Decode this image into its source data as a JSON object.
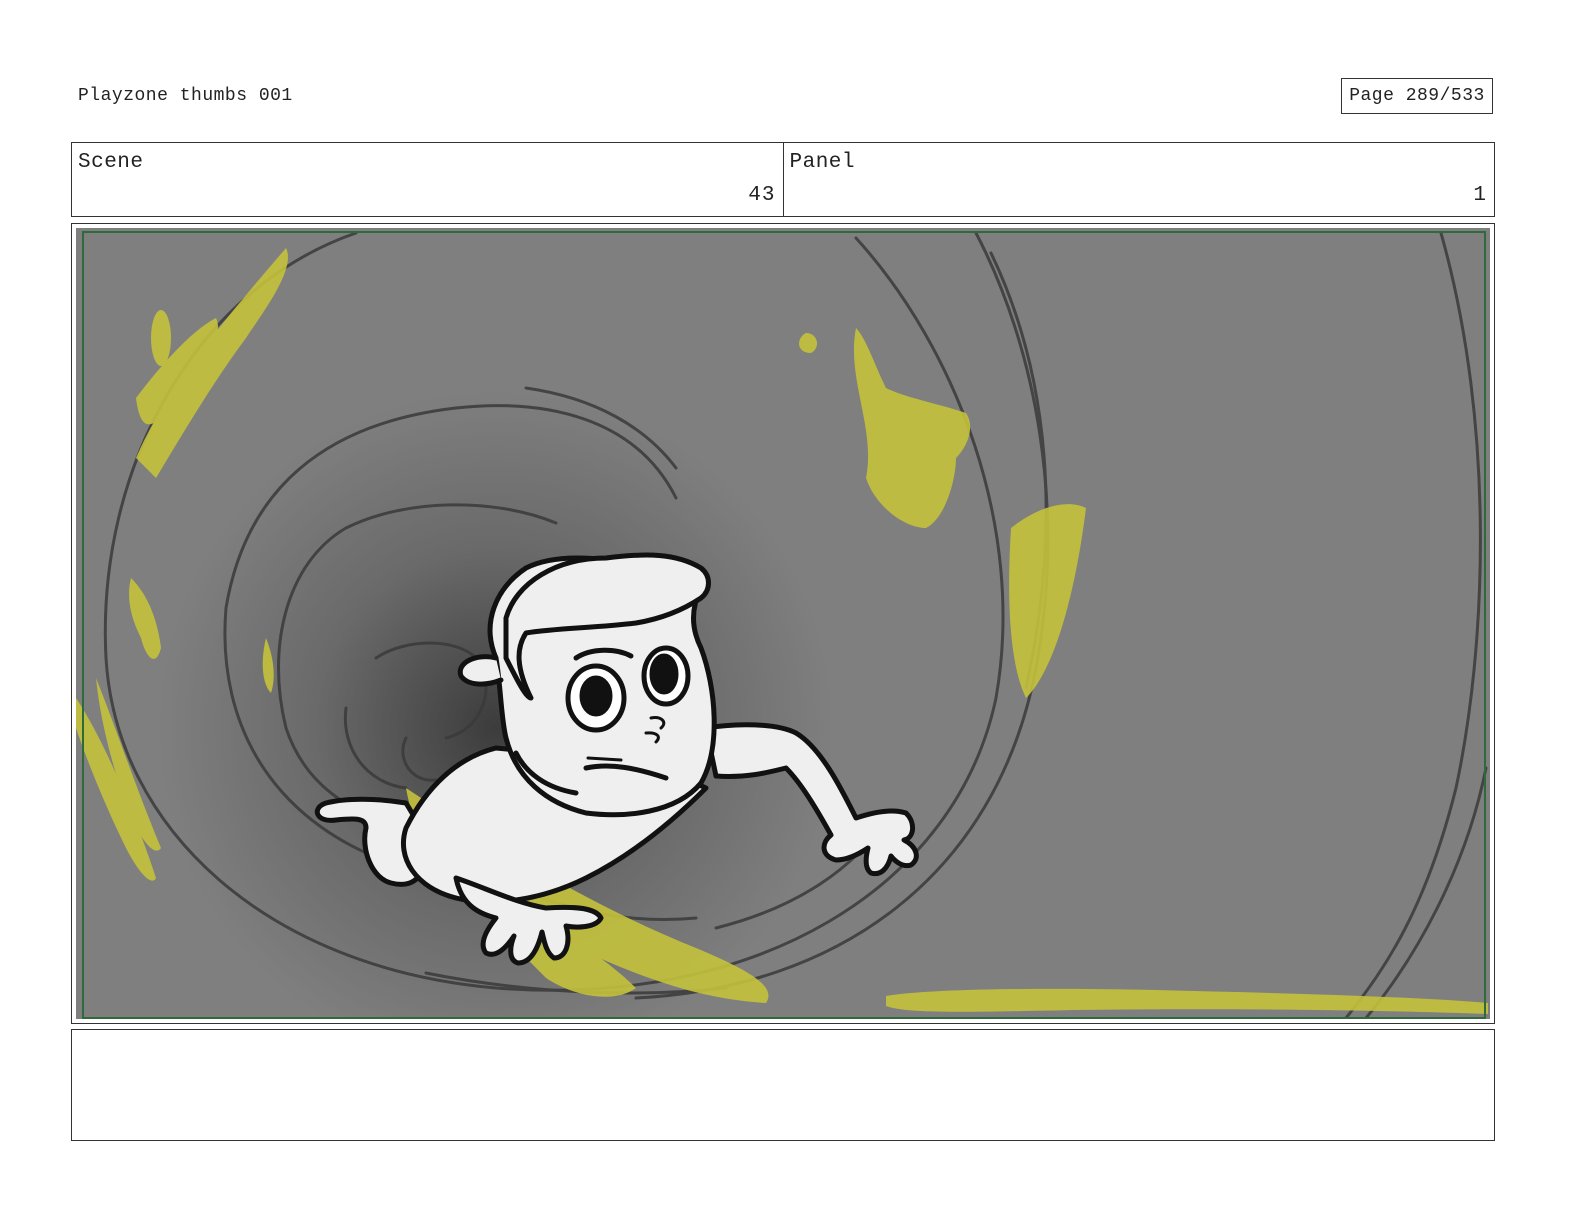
{
  "header": {
    "title": "Playzone thumbs 001",
    "page_label": "Page 289/533"
  },
  "info": {
    "scene_label": "Scene",
    "scene_value": "43",
    "panel_label": "Panel",
    "panel_value": "1"
  },
  "notes": {
    "text": ""
  },
  "colors": {
    "background_gray": "#7f7f7f",
    "tunnel_dark": "#404040",
    "highlight_yellow": "#c4c23c",
    "frame_green": "#2f6b3a",
    "ink": "#111111",
    "character_fill": "#efefef"
  }
}
